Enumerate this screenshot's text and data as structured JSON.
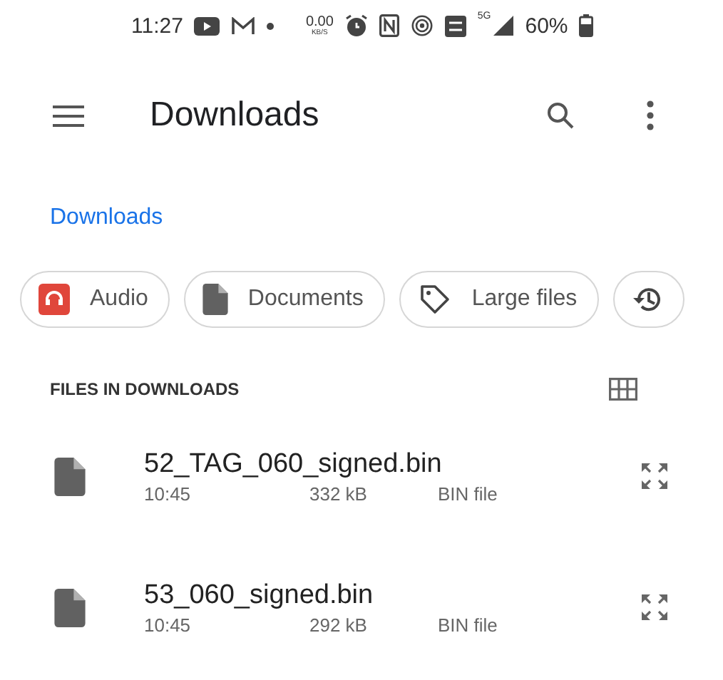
{
  "status_bar": {
    "time": "11:27",
    "speed_value": "0.00",
    "speed_unit": "KB/S",
    "network": "5G",
    "battery": "60%"
  },
  "app_bar": {
    "title": "Downloads"
  },
  "breadcrumb": "Downloads",
  "chips": [
    {
      "kind": "audio",
      "label": "Audio"
    },
    {
      "kind": "document",
      "label": "Documents"
    },
    {
      "kind": "tag",
      "label": "Large files"
    },
    {
      "kind": "history"
    }
  ],
  "section": {
    "title": "FILES IN DOWNLOADS"
  },
  "files": [
    {
      "name": "52_TAG_060_signed.bin",
      "time": "10:45",
      "size": "332 kB",
      "type": "BIN file"
    },
    {
      "name": "53_060_signed.bin",
      "time": "10:45",
      "size": "292 kB",
      "type": "BIN file"
    }
  ]
}
